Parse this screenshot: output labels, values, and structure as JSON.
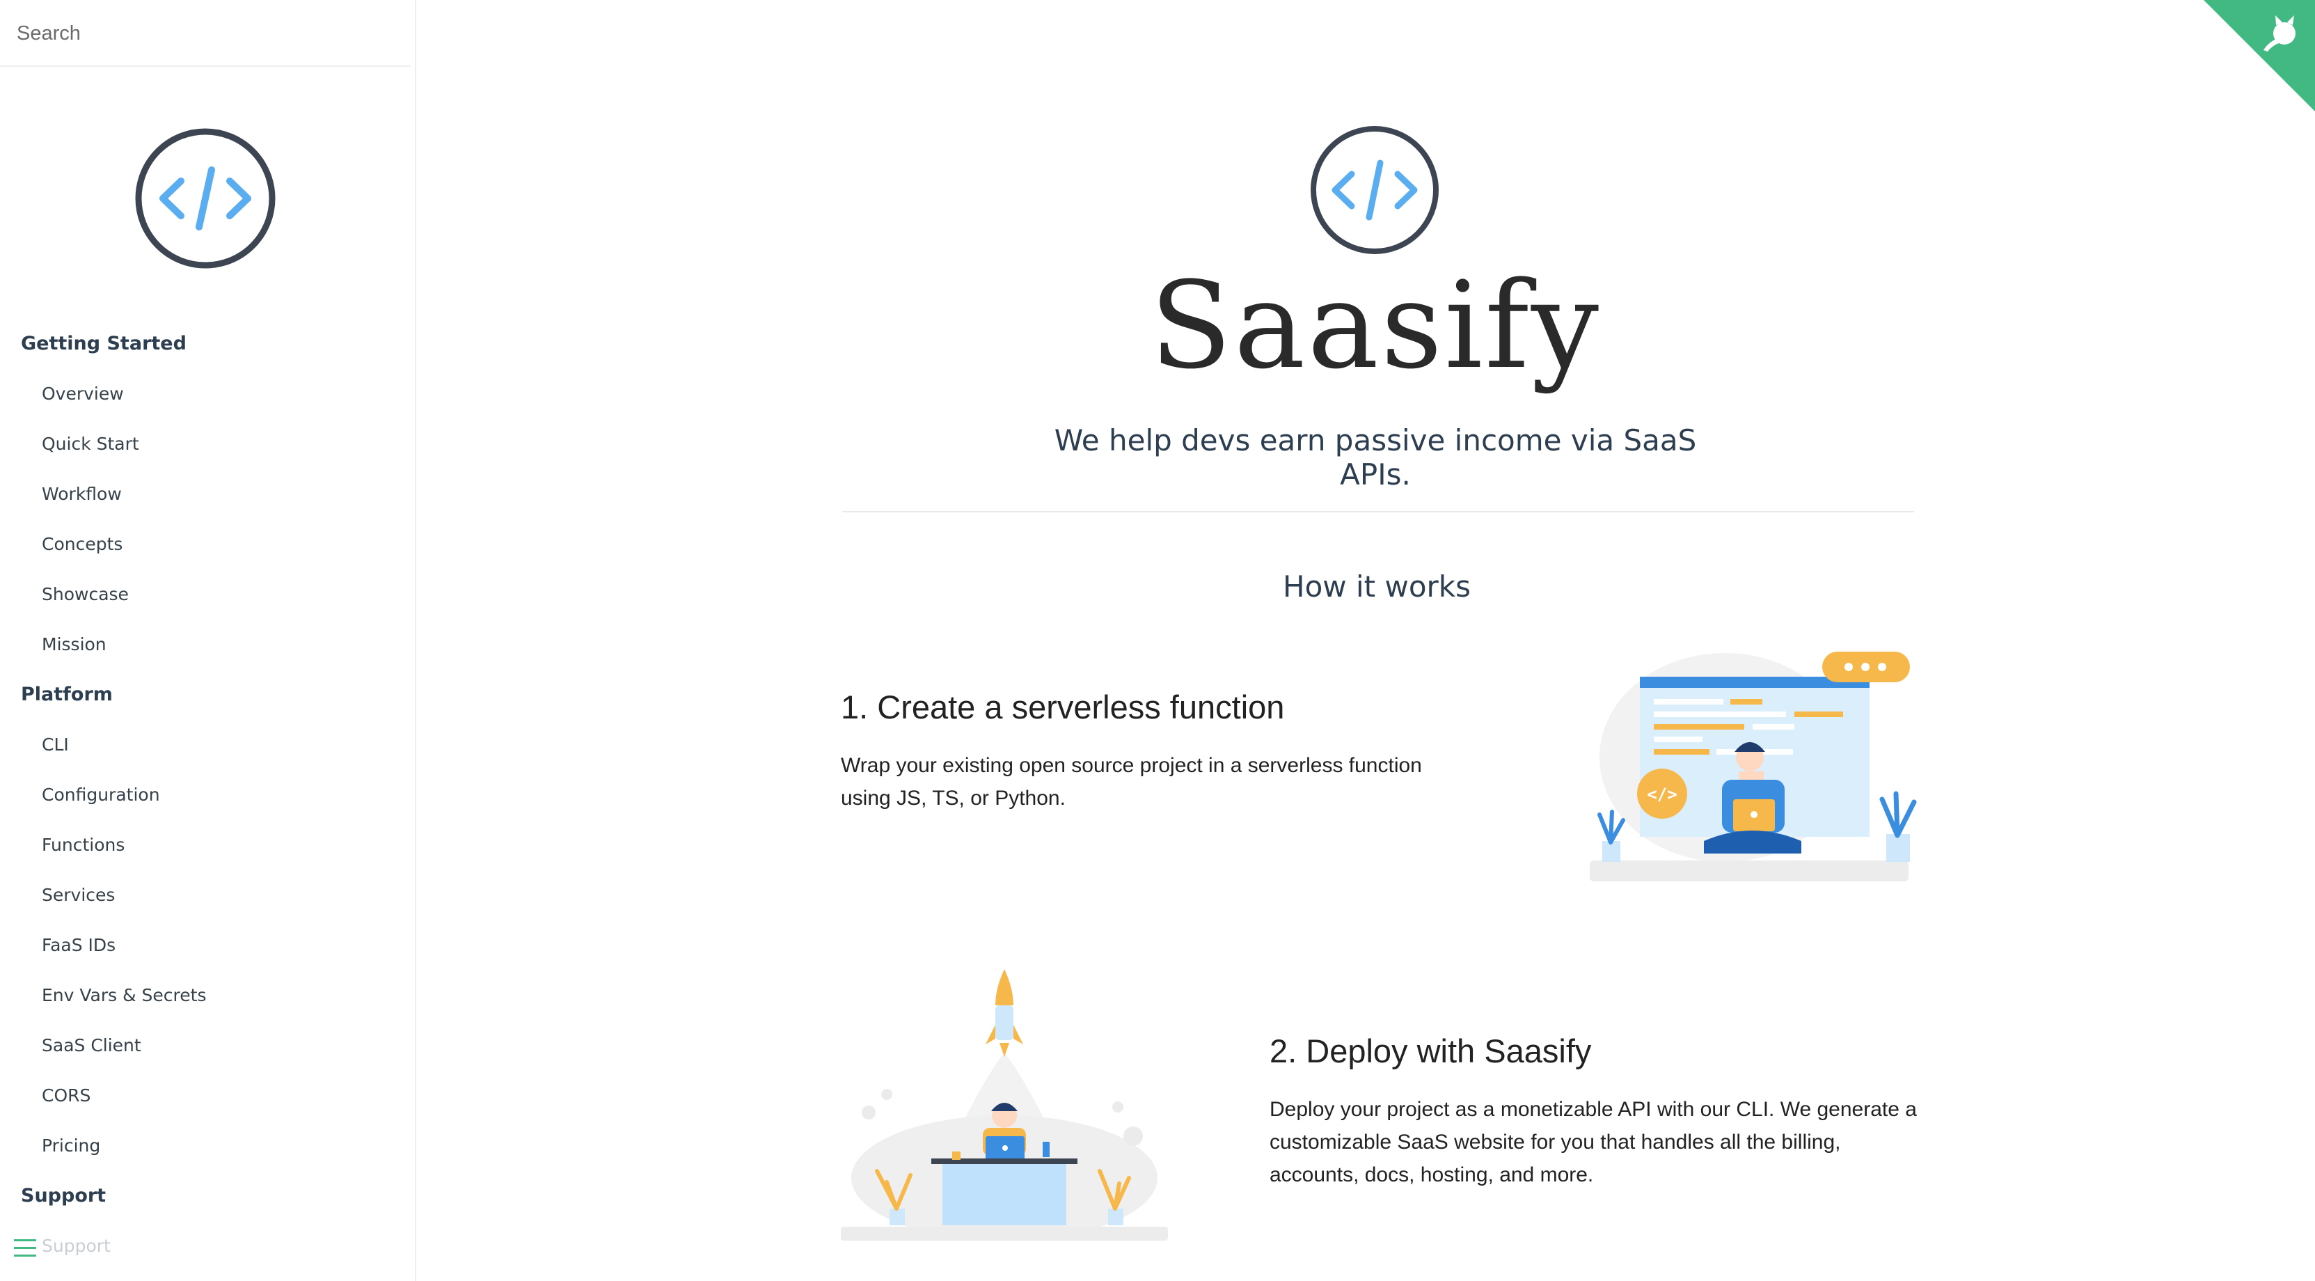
{
  "search": {
    "placeholder": "Search"
  },
  "sidebar": {
    "sections": [
      {
        "title": "Getting Started",
        "items": [
          "Overview",
          "Quick Start",
          "Workflow",
          "Concepts",
          "Showcase",
          "Mission"
        ]
      },
      {
        "title": "Platform",
        "items": [
          "CLI",
          "Configuration",
          "Functions",
          "Services",
          "FaaS IDs",
          "Env Vars & Secrets",
          "SaaS Client",
          "CORS",
          "Pricing"
        ]
      },
      {
        "title": "Support",
        "items": [
          "Support"
        ]
      }
    ]
  },
  "hero": {
    "logo_icon": "code-brackets-logo",
    "title": "Saasify",
    "tagline": "We help devs earn passive income via SaaS APIs."
  },
  "how_it_works": {
    "title": "How it works",
    "steps": [
      {
        "title": "1. Create a serverless function",
        "text": "Wrap your existing open source project in a serverless function using JS, TS, or Python."
      },
      {
        "title": "2. Deploy with Saasify",
        "text": "Deploy your project as a monetizable API with our CLI. We generate a customizable SaaS website for you that handles all the billing, accounts, docs, hosting, and more."
      }
    ]
  },
  "colors": {
    "accent": "#42b983",
    "logo_ring": "#3d4452",
    "logo_brackets": "#5aaef0",
    "illustration_orange": "#f7b84b",
    "illustration_blue": "#3b8de0"
  }
}
